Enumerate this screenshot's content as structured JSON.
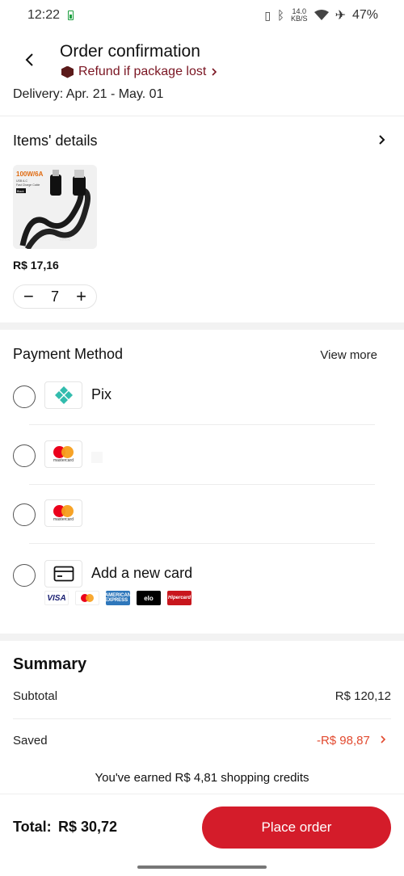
{
  "status_bar": {
    "time": "12:22",
    "net_speed_value": "14.0",
    "net_speed_unit": "KB/S",
    "battery": "47%"
  },
  "header": {
    "title": "Order confirmation",
    "refund_text": "Refund if package lost",
    "delivery": "Delivery: Apr. 21 - May. 01"
  },
  "items": {
    "title": "Items' details",
    "product": {
      "image_caption": "100W/6A",
      "image_sub1": "USB A-C",
      "image_sub2": "Fast Charge Cable",
      "image_tag": "Black",
      "brand": "toocki",
      "price": "R$ 17,16",
      "quantity": "7"
    }
  },
  "payment": {
    "title": "Payment Method",
    "view_more": "View more",
    "options": [
      {
        "label": "Pix",
        "icon": "pix-icon"
      },
      {
        "label": "",
        "icon": "mastercard-icon"
      },
      {
        "label": "",
        "icon": "mastercard-icon"
      },
      {
        "label": "Add a new card",
        "icon": "credit-card-icon"
      }
    ],
    "card_brands": [
      "VISA",
      "mastercard",
      "AMERICAN EXPRESS",
      "elo",
      "Hipercard"
    ],
    "mastercard_word": "mastercard"
  },
  "summary": {
    "title": "Summary",
    "subtotal_label": "Subtotal",
    "subtotal_value": "R$ 120,12",
    "saved_label": "Saved",
    "saved_value": "-R$ 98,87",
    "credits_text": "You've earned R$ 4,81 shopping credits"
  },
  "footer": {
    "total_label": "Total:",
    "total_value": "R$ 30,72",
    "place_order": "Place order"
  },
  "colors": {
    "primary": "#d41c2a",
    "saved": "#e24a2f",
    "refund": "#7a1522",
    "pix": "#32bcad"
  }
}
